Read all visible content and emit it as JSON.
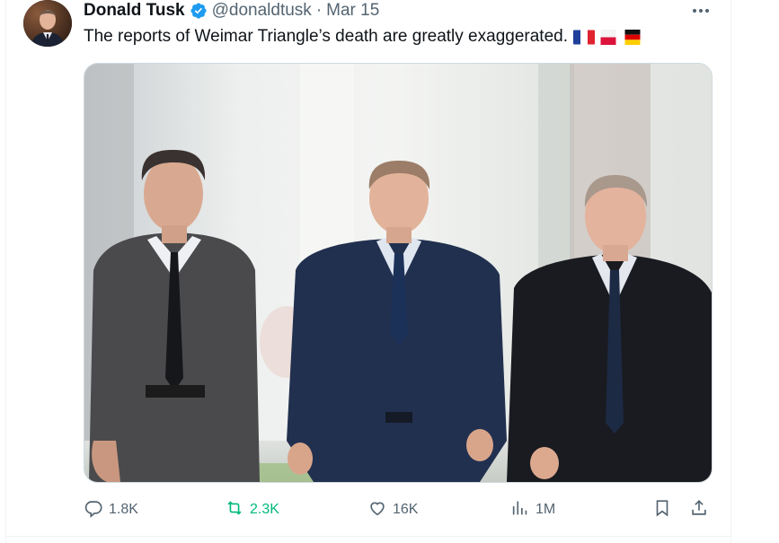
{
  "tweet": {
    "author_name": "Donald Tusk",
    "handle": "@donaldtusk",
    "separator": "·",
    "date": "Mar 15",
    "text": "The reports of Weimar Triangle’s death are greatly exaggerated.",
    "flags": [
      "France",
      "Poland",
      "Germany"
    ],
    "verified": true
  },
  "metrics": {
    "replies": "1.8K",
    "reposts": "2.3K",
    "likes": "16K",
    "views": "1M"
  },
  "colors": {
    "text_primary": "#0f1419",
    "text_secondary": "#536471",
    "verified_blue": "#1d9bf0",
    "repost_green": "#00ba7c",
    "border": "#cfd9de"
  },
  "icons": {
    "more": "more-icon",
    "reply": "reply-icon",
    "repost": "repost-icon",
    "like": "like-icon",
    "views": "views-icon",
    "bookmark": "bookmark-icon",
    "share": "share-icon",
    "verified": "verified-badge-icon"
  }
}
